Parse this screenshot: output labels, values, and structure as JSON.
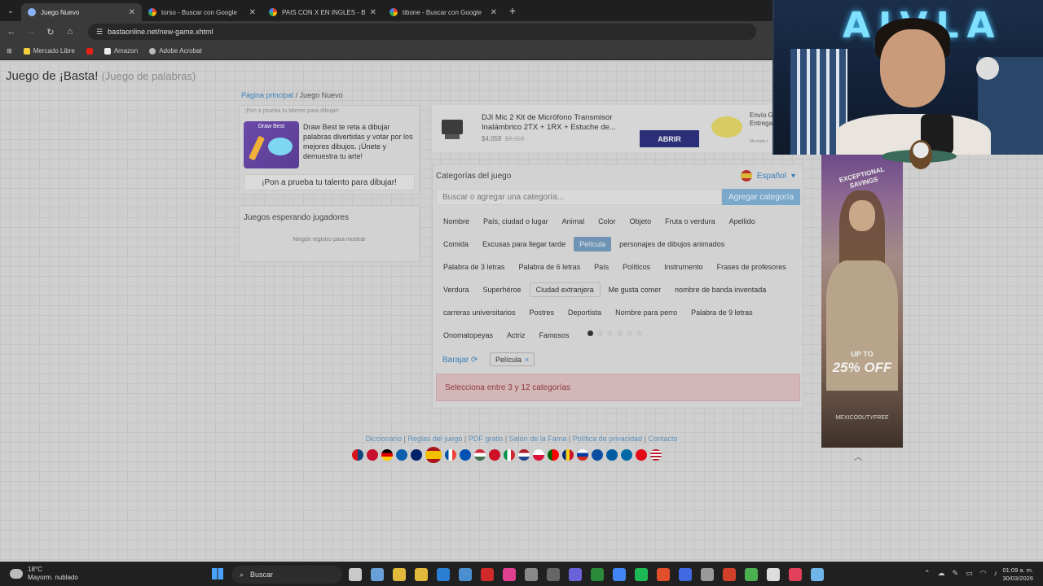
{
  "browser": {
    "tabs": [
      {
        "label": "Juego Nuevo",
        "active": true
      },
      {
        "label": "torso - Buscar con Google",
        "active": false
      },
      {
        "label": "PAIS CON X EN INGLES - Buscar",
        "active": false
      },
      {
        "label": "tibone - Buscar con Google",
        "active": false
      }
    ],
    "new_tab": "+",
    "url": "bastaonline.net/new-game.xhtml",
    "bookmarks": [
      {
        "label": "Mercado Libre",
        "icon": "mercadolibre-icon"
      },
      {
        "label": "",
        "icon": "youtube-icon"
      },
      {
        "label": "Amazon",
        "icon": "amazon-icon"
      },
      {
        "label": "Adobe Acrobat",
        "icon": "acrobat-icon"
      }
    ]
  },
  "header": {
    "title": "Juego de ¡Basta!",
    "subtitle": "(Juego de palabras)"
  },
  "breadcrumb": {
    "home": "Página principal",
    "sep": "/",
    "current": "Juego Nuevo"
  },
  "promo": {
    "hint": "¡Pon a prueba tu talento para dibujar!",
    "thumb_title": "Draw Best",
    "description": "Draw Best te reta a dibujar palabras divertidas y votar por los mejores dibujos. ¡Únete y demuestra tu arte!",
    "cta": "¡Pon a prueba tu talento para dibujar!"
  },
  "waiting": {
    "title": "Juegos esperando jugadores",
    "empty": "Ningún registro para mostrar"
  },
  "ad": {
    "product": "DJI Mic 2 Kit de Micrófono Transmisor Inalámbrico 2TX + 1RX + Estuche de...",
    "price": "$4,059",
    "old_price": "$8,118",
    "button": "ABRIR",
    "side_text": "Envío G Entrega",
    "side_small": "Mercado L"
  },
  "categories": {
    "title": "Categorías del juego",
    "language": "Español",
    "search_placeholder": "Buscar o agregar una categoría...",
    "add_button": "Agregar categoría",
    "chips": [
      "Nombre",
      "País, ciudad o lugar",
      "Animal",
      "Color",
      "Objeto",
      "Fruta o verdura",
      "Apellido",
      "Comida",
      "Excusas para llegar tarde",
      "Película",
      "personajes de dibujos animados",
      "Palabra de 3 letras",
      "Palabra de 6 letras",
      "País",
      "Políticos",
      "Instrumento",
      "Frases de profesores",
      "Verdura",
      "Superhéroe",
      "Ciudad extranjera",
      "Me gusta comer",
      "nombre de banda inventada",
      "carreras universitarios",
      "Postres",
      "Deportista",
      "Nombre para perro",
      "Palabra de 9 letras",
      "Onomatopeyas",
      "Actriz",
      "Famosos"
    ],
    "selected_chip": "Película",
    "hovered_chip": "Ciudad extranjera",
    "pages": 6,
    "current_page": 1,
    "shuffle": "Barajar",
    "selected": [
      {
        "label": "Película",
        "remove": "×"
      }
    ],
    "alert": "Selecciona entre 3 y 12 categorías"
  },
  "footer": {
    "links": [
      "Diccionario",
      "Reglas del juego",
      "PDF gratis",
      "Salón de la Fama",
      "Política de privacidad",
      "Contacto"
    ],
    "separator": "|"
  },
  "side_ad": {
    "headline": "EXCEPTIONAL SAVINGS",
    "upto": "UP TO",
    "percent": "25% OFF",
    "brand": "MEXICODUTYFREE"
  },
  "webcam": {
    "neon_text": "AJVLA"
  },
  "taskbar": {
    "temp": "18°C",
    "weather": "Mayorm. nublado",
    "search": "Buscar",
    "time": "01:09 a. m.",
    "date": "30/03/2026"
  },
  "colors": {
    "link": "#3a7fb8",
    "primary_button": "#2b2f78",
    "alert_bg": "#d3b6b8",
    "selected_chip": "#6e93b3"
  }
}
